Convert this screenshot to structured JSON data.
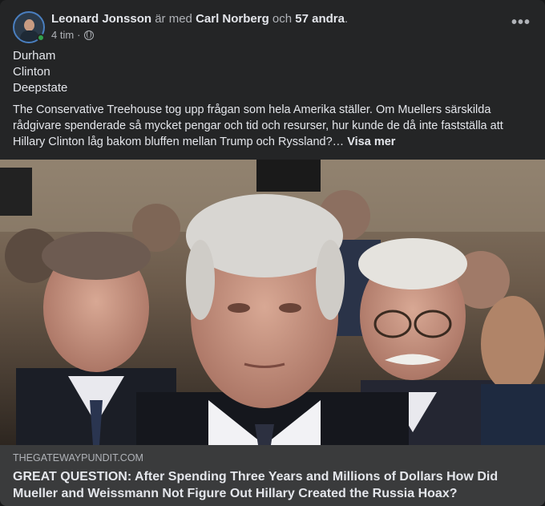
{
  "post": {
    "author": "Leonard Jonsson",
    "with_text": "är med",
    "tagged": "Carl Norberg",
    "and_text": "och",
    "others": "57 andra",
    "period": ".",
    "time": "4 tim",
    "separator": "·",
    "privacy_icon": "globe-icon",
    "more_icon": "more-options-icon",
    "more_label": "•••"
  },
  "content": {
    "tags": [
      "Durham",
      "Clinton",
      "Deepstate"
    ],
    "body": "The Conservative Treehouse tog upp frågan som hela Amerika ställer. Om Muellers särskilda rådgivare spenderade så mycket pengar och tid och resurser, hur kunde de då inte fastställa att Hillary Clinton låg bakom bluffen mellan Trump och Ryssland?…",
    "see_more": "Visa mer"
  },
  "link_preview": {
    "domain": "THEGATEWAYPUNDIT.COM",
    "title": "GREAT QUESTION: After Spending Three Years and Millions of Dollars How Did Mueller and Weissmann Not Figure Out Hillary Created the Russia Hoax?"
  },
  "colors": {
    "card_bg": "#242526",
    "link_bg": "#3a3b3c",
    "text_primary": "#e4e6eb",
    "text_secondary": "#b0b3b8",
    "online": "#31a24c"
  }
}
